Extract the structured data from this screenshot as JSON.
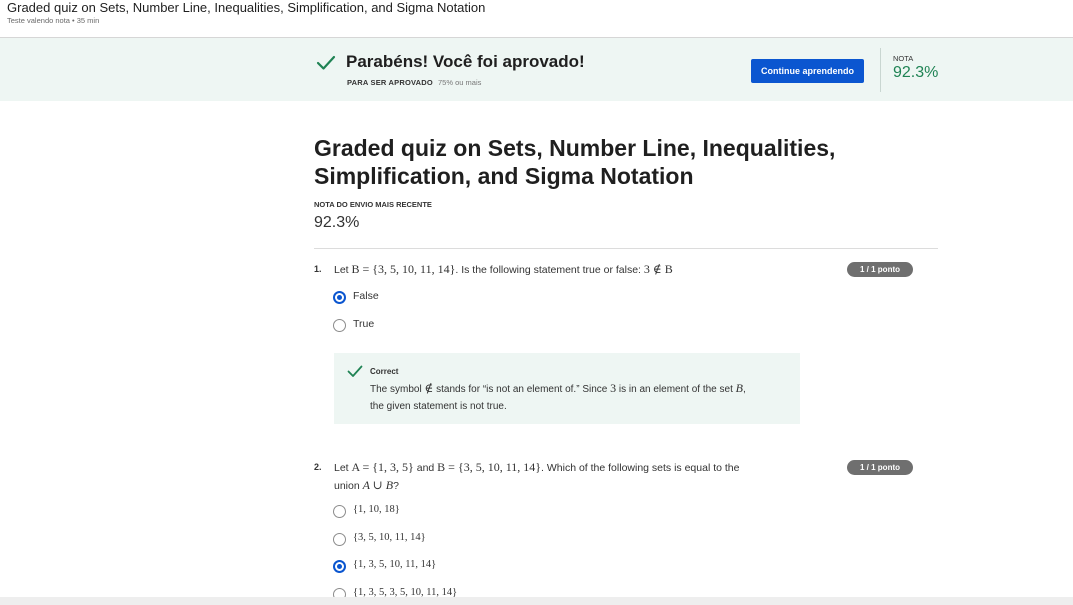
{
  "header": {
    "title": "Graded quiz on Sets, Number Line, Inequalities, Simplification, and Sigma Notation",
    "subtitle": "Teste valendo nota • 35 min"
  },
  "banner": {
    "title": "Parabéns! Você foi aprovado!",
    "pass_label": "PARA SER APROVADO",
    "pass_value": "75% ou mais",
    "button_label": "Continue aprendendo",
    "grade_label": "NOTA",
    "grade_value": "92.3%"
  },
  "page": {
    "title": "Graded quiz on Sets, Number Line, Inequalities, Simplification, and Sigma Notation",
    "recent_label": "NOTA DO ENVIO MAIS RECENTE",
    "recent_value": "92.3%"
  },
  "questions": [
    {
      "number": "1.",
      "points": "1 / 1 ponto",
      "t1": "Let ",
      "m1": "B = {3, 5, 10, 11, 14}",
      "t2": ". Is the following statement true or false: ",
      "m2": "3 ∉ B",
      "options": [
        {
          "label": "False",
          "selected": true
        },
        {
          "label": "True",
          "selected": false
        }
      ],
      "feedback": {
        "label": "Correct",
        "t1": "The symbol ",
        "m1": "∉",
        "t2": " stands for “is not an element of.” Since ",
        "m2": "3",
        "t3": " is in an element of the set ",
        "m3": "B",
        "t4": ",",
        "t5": "the given statement is not true."
      }
    },
    {
      "number": "2.",
      "points": "1 / 1 ponto",
      "t1": "Let ",
      "m1": "A = {1, 3, 5}",
      "t2": " and ",
      "m2": "B = {3, 5, 10, 11, 14}",
      "t3": ". Which of the following sets is equal to the",
      "t4": "union ",
      "m3": "A ∪ B",
      "t5": "?",
      "options": [
        {
          "label": "{1, 10, 18}",
          "selected": false
        },
        {
          "label": "{3, 5, 10, 11, 14}",
          "selected": false
        },
        {
          "label": "{1, 3, 5, 10, 11, 14}",
          "selected": true
        },
        {
          "label": "{1, 3, 5, 3, 5, 10, 11, 14}",
          "selected": false
        }
      ]
    }
  ],
  "colors": {
    "accent": "#0b56d0",
    "success": "#1f8354",
    "banner_bg": "#eef6f3",
    "pill_bg": "#6f6f6f"
  },
  "icons": {
    "banner": "check-icon",
    "feedback": "check-icon"
  }
}
